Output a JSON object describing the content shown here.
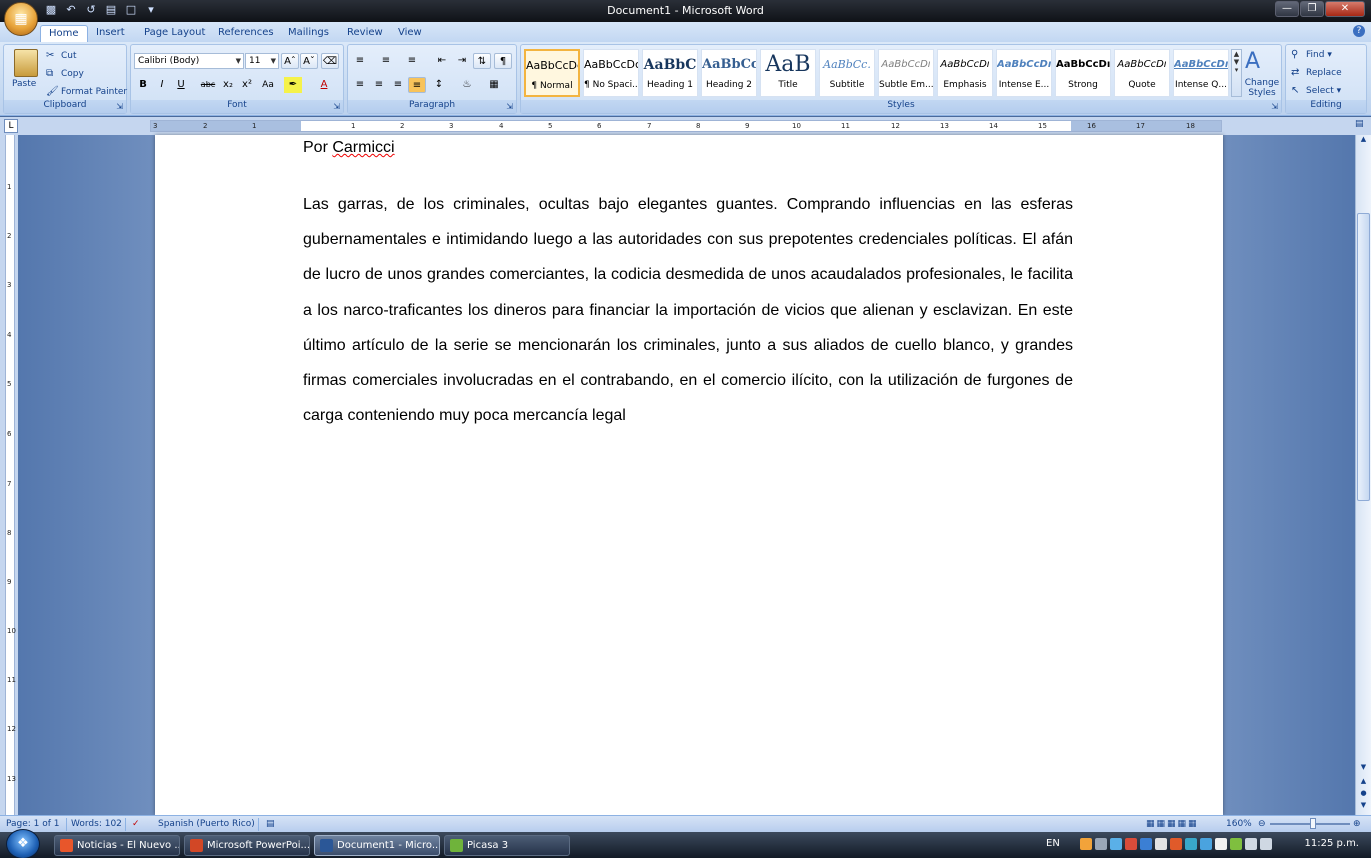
{
  "window": {
    "title": "Document1 - Microsoft Word"
  },
  "ribbon_tabs": [
    "Home",
    "Insert",
    "Page Layout",
    "References",
    "Mailings",
    "Review",
    "View"
  ],
  "clipboard": {
    "paste": "Paste",
    "cut": "Cut",
    "copy": "Copy",
    "format_painter": "Format Painter",
    "label": "Clipboard"
  },
  "font": {
    "name": "Calibri (Body)",
    "size": "11",
    "label": "Font"
  },
  "paragraph": {
    "label": "Paragraph"
  },
  "styles": {
    "label": "Styles",
    "items": [
      {
        "sample": "AaBbCcDc",
        "name": "¶ Normal"
      },
      {
        "sample": "AaBbCcDc",
        "name": "¶ No Spaci..."
      },
      {
        "sample": "AaBbC",
        "name": "Heading 1"
      },
      {
        "sample": "AaBbCc",
        "name": "Heading 2"
      },
      {
        "sample": "AaB",
        "name": "Title"
      },
      {
        "sample": "AaBbCc.",
        "name": "Subtitle"
      },
      {
        "sample": "AaBbCcDı",
        "name": "Subtle Em..."
      },
      {
        "sample": "AaBbCcDı",
        "name": "Emphasis"
      },
      {
        "sample": "AaBbCcDı",
        "name": "Intense E..."
      },
      {
        "sample": "AaBbCcDı",
        "name": "Strong"
      },
      {
        "sample": "AaBbCcDı",
        "name": "Quote"
      },
      {
        "sample": "AaBbCcDı",
        "name": "Intense Q..."
      }
    ],
    "change_styles": "Change Styles"
  },
  "editing": {
    "find": "Find",
    "replace": "Replace",
    "select": "Select",
    "label": "Editing"
  },
  "ruler_numbers_h": [
    "3",
    "2",
    "1",
    "1",
    "2",
    "3",
    "4",
    "5",
    "6",
    "7",
    "8",
    "9",
    "10",
    "11",
    "12",
    "13",
    "14",
    "15",
    "16",
    "17",
    "18"
  ],
  "ruler_numbers_v": [
    "1",
    "2",
    "3",
    "4",
    "5",
    "6",
    "7",
    "8",
    "9",
    "10",
    "11",
    "12",
    "13"
  ],
  "document": {
    "author_prefix": "Por ",
    "author_name": "Carmicci",
    "body": "Las garras, de los criminales, ocultas bajo elegantes guantes. Comprando influencias en las esferas gubernamentales e intimidando luego a las autoridades con sus prepotentes credenciales políticas. El afán de lucro de unos grandes comerciantes, la codicia desmedida de unos acaudalados profesionales, le facilita a los narco-traficantes los dineros para financiar la importación de vicios que alienan y esclavizan. En este último artículo de la serie se mencionarán los criminales, junto a sus aliados de cuello blanco, y grandes firmas comerciales involucradas en el contrabando, en el comercio ilícito, con la utilización de furgones de carga conteniendo muy poca mercancía legal"
  },
  "status": {
    "page": "Page: 1 of 1",
    "words": "Words: 102",
    "language": "Spanish (Puerto Rico)",
    "zoom": "160%"
  },
  "taskbar": {
    "tasks": [
      {
        "label": "Noticias - El Nuevo ...",
        "color": "#e8562b"
      },
      {
        "label": "Microsoft PowerPoi...",
        "color": "#d24726"
      },
      {
        "label": "Document1 - Micro...",
        "color": "#2b5797"
      },
      {
        "label": "Picasa 3",
        "color": "#6fb33b"
      }
    ],
    "language": "EN",
    "clock": "11:25 p.m."
  }
}
